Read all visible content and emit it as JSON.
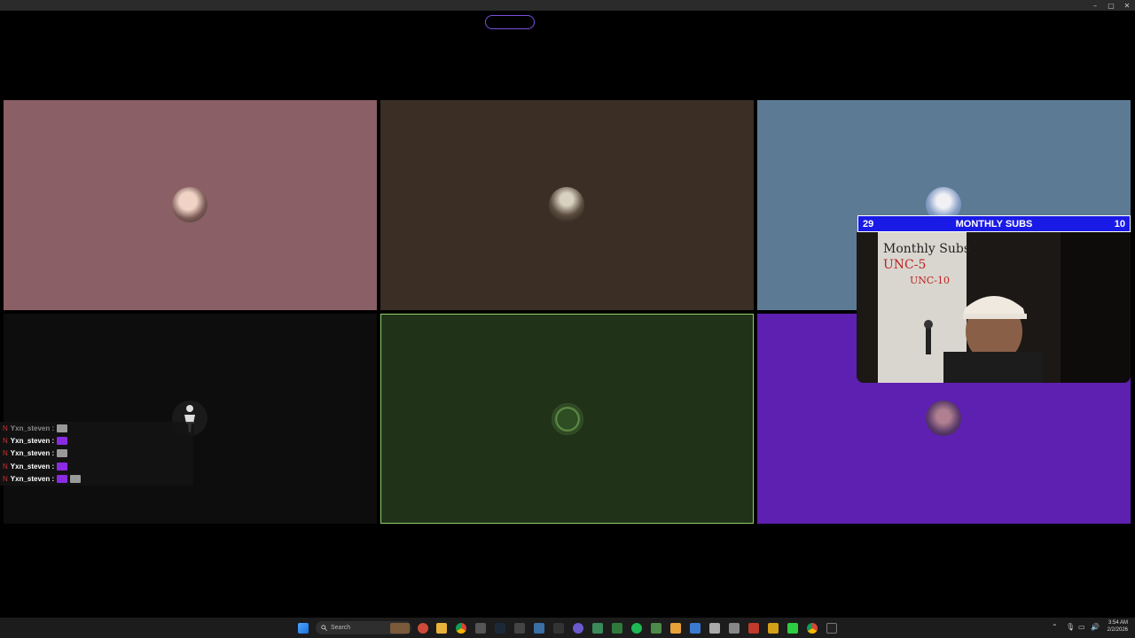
{
  "window": {
    "controls": [
      "–",
      "▢",
      "✕"
    ]
  },
  "grid": {
    "tiles": [
      {
        "id": "tile-1",
        "bg": "#8a5f65",
        "avatar_icon": "user-avatar-icon"
      },
      {
        "id": "tile-2",
        "bg": "#3a2e25",
        "avatar_icon": "user-avatar-icon"
      },
      {
        "id": "tile-3",
        "bg": "#5c7a94",
        "avatar_icon": "user-avatar-icon"
      },
      {
        "id": "tile-4",
        "bg": "#0d0d0d",
        "avatar_icon": "silhouette-avatar-icon"
      },
      {
        "id": "tile-5",
        "bg": "#203319",
        "avatar_icon": "logo-avatar-icon",
        "highlight": true
      },
      {
        "id": "tile-6",
        "bg": "#5e20b0",
        "avatar_icon": "user-avatar-icon"
      }
    ]
  },
  "chat": {
    "messages": [
      {
        "badge": "N",
        "user": "Yxn_steven :",
        "emotes": [
          "grey"
        ]
      },
      {
        "badge": "N",
        "user": "Yxn_steven :",
        "emotes": [
          "purple"
        ]
      },
      {
        "badge": "N",
        "user": "Yxn_steven :",
        "emotes": [
          "grey"
        ]
      },
      {
        "badge": "N",
        "user": "Yxn_steven :",
        "emotes": [
          "purple"
        ]
      },
      {
        "badge": "N",
        "user": "Yxn_steven :",
        "emotes": [
          "purple",
          "grey"
        ]
      }
    ]
  },
  "sub_goal": {
    "left_value": "29",
    "title": "MONTHLY SUBS",
    "right_value": "10"
  },
  "webcam": {
    "whiteboard_lines": [
      "Monthly Subs",
      "UNC-5",
      "UNC-10"
    ]
  },
  "taskbar": {
    "search_placeholder": "Search",
    "time": "3:54 AM",
    "date": "2/2/2026"
  },
  "colors": {
    "accent_pill": "#7b4fe0",
    "sub_bar": "#1a1ae6",
    "highlight_border": "#8fcf6a"
  }
}
